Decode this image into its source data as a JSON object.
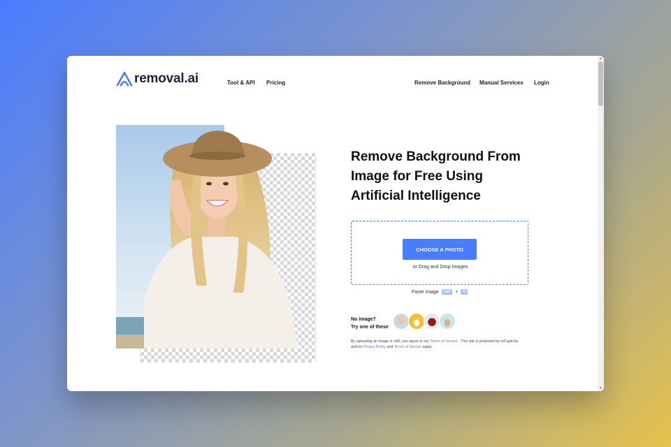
{
  "nav": {
    "brand": "removal.ai",
    "left_links": [
      "Tool & API",
      "Pricing"
    ],
    "right_links": [
      "Remove Background",
      "Manual Services",
      "Login"
    ]
  },
  "hero": {
    "headline_lines": [
      "Remove Background From",
      "Image for Free Using",
      "Artificial Intelligence"
    ]
  },
  "upload": {
    "button_label": "CHOOSE A PHOTO",
    "drag_text": "or Drag and Drop Images",
    "paste_label": "Paste image",
    "key_ctrl": "ctrl",
    "plus": "+",
    "key_v": "V"
  },
  "samples": {
    "label_line1": "No image?",
    "label_line2": "Try one of these",
    "items": [
      "sample-person",
      "sample-car",
      "sample-bag",
      "sample-dog"
    ]
  },
  "terms": {
    "t1": "By uploading an image or URL you agree to our ",
    "link1": "Terms of Service",
    "t2": " . This site is protected by reCaptcha and its ",
    "link2": "Privacy Policy",
    "t3": " and ",
    "link3": "Terms of Service",
    "t4": " apply."
  },
  "colors": {
    "accent": "#4a7cff",
    "brand_dark": "#1c2340"
  }
}
